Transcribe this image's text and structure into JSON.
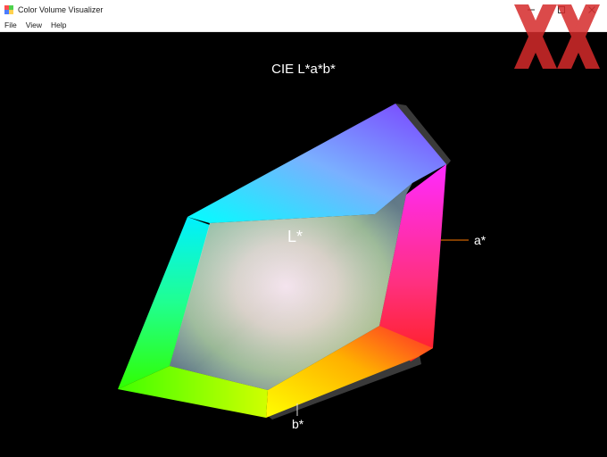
{
  "window": {
    "title": "Color Volume Visualizer",
    "controls": {
      "minimize_icon": "minimize-icon",
      "maximize_icon": "maximize-icon",
      "close_icon": "close-icon"
    }
  },
  "menu": {
    "items": [
      "File",
      "View",
      "Help"
    ]
  },
  "view": {
    "title": "CIE L*a*b*",
    "axes": {
      "l": "L*",
      "a": "a*",
      "b": "b*"
    },
    "axis_colors": {
      "a_line": "#ff7a00"
    }
  },
  "watermark": {
    "icon": "logo-xx-watermark",
    "color": "#d52b2b"
  }
}
